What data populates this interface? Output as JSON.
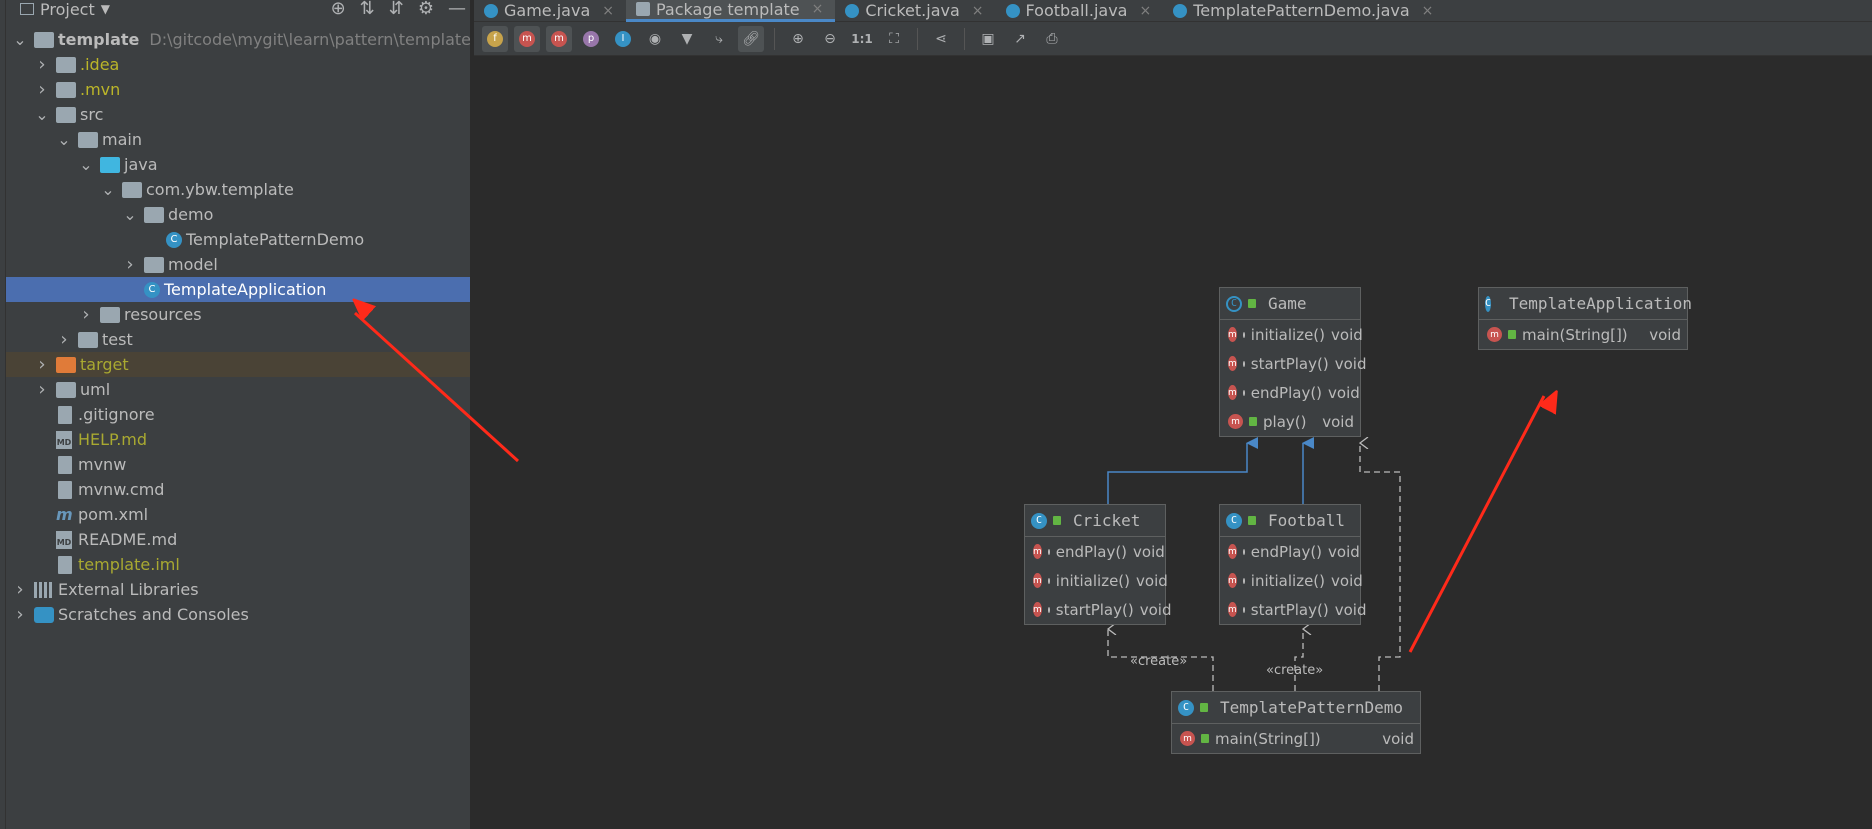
{
  "project_panel": {
    "title": "Project",
    "tree": [
      {
        "label": "template",
        "path": "D:\\gitcode\\mygit\\learn\\pattern\\template",
        "indent": 0,
        "arrow": "down",
        "icon": "folder"
      },
      {
        "label": ".idea",
        "indent": 1,
        "arrow": "right",
        "icon": "folder",
        "color": "yellow"
      },
      {
        "label": ".mvn",
        "indent": 1,
        "arrow": "right",
        "icon": "folder",
        "color": "yellow"
      },
      {
        "label": "src",
        "indent": 1,
        "arrow": "down",
        "icon": "folder"
      },
      {
        "label": "main",
        "indent": 2,
        "arrow": "down",
        "icon": "folder"
      },
      {
        "label": "java",
        "indent": 3,
        "arrow": "down",
        "icon": "folder-blue"
      },
      {
        "label": "com.ybw.template",
        "indent": 4,
        "arrow": "down",
        "icon": "package"
      },
      {
        "label": "demo",
        "indent": 5,
        "arrow": "down",
        "icon": "package"
      },
      {
        "label": "TemplatePatternDemo",
        "indent": 6,
        "arrow": "",
        "icon": "class"
      },
      {
        "label": "model",
        "indent": 5,
        "arrow": "right",
        "icon": "package"
      },
      {
        "label": "TemplateApplication",
        "indent": 5,
        "arrow": "",
        "icon": "class",
        "selected": true
      },
      {
        "label": "resources",
        "indent": 3,
        "arrow": "right",
        "icon": "folder"
      },
      {
        "label": "test",
        "indent": 2,
        "arrow": "right",
        "icon": "folder"
      },
      {
        "label": "target",
        "indent": 1,
        "arrow": "right",
        "icon": "folder-orange",
        "color": "olive",
        "excluded": true
      },
      {
        "label": "uml",
        "indent": 1,
        "arrow": "right",
        "icon": "folder"
      },
      {
        "label": ".gitignore",
        "indent": 1,
        "arrow": "",
        "icon": "file"
      },
      {
        "label": "HELP.md",
        "indent": 1,
        "arrow": "",
        "icon": "md",
        "color": "olive"
      },
      {
        "label": "mvnw",
        "indent": 1,
        "arrow": "",
        "icon": "file"
      },
      {
        "label": "mvnw.cmd",
        "indent": 1,
        "arrow": "",
        "icon": "file"
      },
      {
        "label": "pom.xml",
        "indent": 1,
        "arrow": "",
        "icon": "maven"
      },
      {
        "label": "README.md",
        "indent": 1,
        "arrow": "",
        "icon": "md"
      },
      {
        "label": "template.iml",
        "indent": 1,
        "arrow": "",
        "icon": "file",
        "color": "olive"
      },
      {
        "label": "External Libraries",
        "indent": 0,
        "arrow": "right",
        "icon": "libs"
      },
      {
        "label": "Scratches and Consoles",
        "indent": 0,
        "arrow": "right",
        "icon": "scratch"
      }
    ]
  },
  "tabs": [
    {
      "label": "Game.java",
      "active": false
    },
    {
      "label": "Package template",
      "active": true
    },
    {
      "label": "Cricket.java",
      "active": false
    },
    {
      "label": "Football.java",
      "active": false
    },
    {
      "label": "TemplatePatternDemo.java",
      "active": false
    }
  ],
  "toolbar": {
    "zoom_actual_label": "1:1"
  },
  "diagram": {
    "classes": [
      {
        "id": "game",
        "name": "Game",
        "abstract": true,
        "methods": [
          {
            "name": "initialize()",
            "ret": "void"
          },
          {
            "name": "startPlay()",
            "ret": "void"
          },
          {
            "name": "endPlay()",
            "ret": "void"
          },
          {
            "name": "play()",
            "ret": "void"
          }
        ]
      },
      {
        "id": "templateapp",
        "name": "TemplateApplication",
        "methods": [
          {
            "name": "main(String[])",
            "ret": "void"
          }
        ]
      },
      {
        "id": "cricket",
        "name": "Cricket",
        "methods": [
          {
            "name": "endPlay()",
            "ret": "void"
          },
          {
            "name": "initialize()",
            "ret": "void"
          },
          {
            "name": "startPlay()",
            "ret": "void"
          }
        ]
      },
      {
        "id": "football",
        "name": "Football",
        "methods": [
          {
            "name": "endPlay()",
            "ret": "void"
          },
          {
            "name": "initialize()",
            "ret": "void"
          },
          {
            "name": "startPlay()",
            "ret": "void"
          }
        ]
      },
      {
        "id": "demo",
        "name": "TemplatePatternDemo",
        "methods": [
          {
            "name": "main(String[])",
            "ret": "void"
          }
        ]
      }
    ],
    "stereotype_label": "«create»"
  },
  "colors": {
    "selection": "#4b6eaf",
    "arrow_annotation": "#ff2a1a",
    "inheritance": "#4a88c7"
  }
}
